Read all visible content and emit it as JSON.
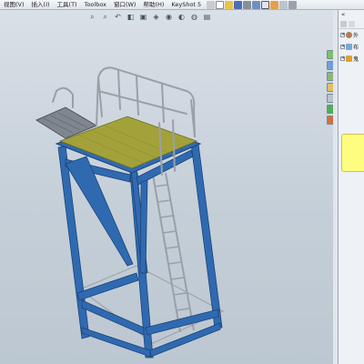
{
  "menu": {
    "items": [
      "视图(V)",
      "插入(I)",
      "工具(T)",
      "Toolbox",
      "窗口(W)",
      "帮助(H)",
      "KeyShot 5"
    ]
  },
  "right_panel": {
    "collapse_label": "«",
    "tree": [
      {
        "label": "外"
      },
      {
        "label": "布"
      },
      {
        "label": "鬼"
      }
    ]
  },
  "colors": {
    "frame_blue": "#2f6ab1",
    "deck_olive": "#a3a13a",
    "rail_gray": "#9aa0a8",
    "note_yellow": "#fffd80"
  },
  "icons": {
    "heads_up": [
      "zoom-to-fit-icon",
      "zoom-area-icon",
      "previous-view-icon",
      "section-view-icon",
      "view-orientation-icon",
      "display-style-icon",
      "hide-show-icon",
      "edit-appearance-icon",
      "apply-scene-icon",
      "view-settings-icon"
    ]
  }
}
